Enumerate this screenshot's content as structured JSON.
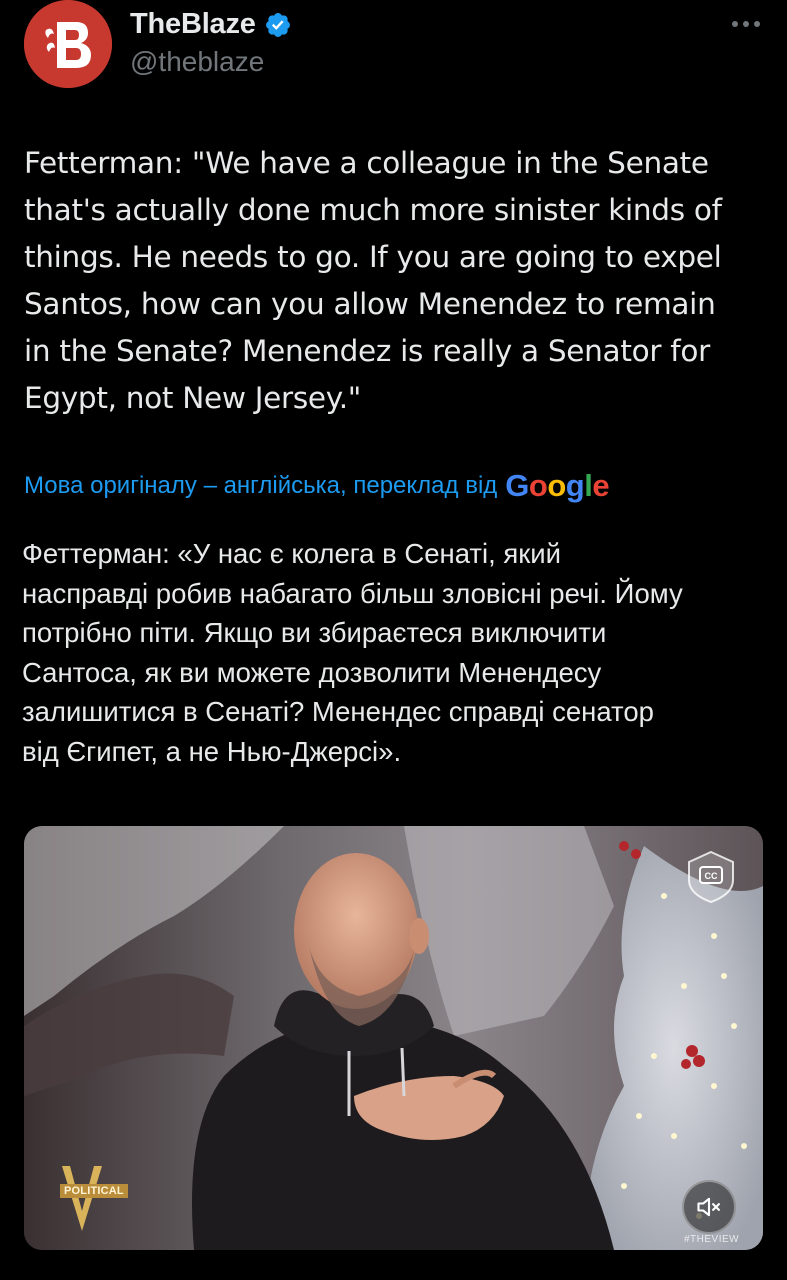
{
  "author": {
    "display_name": "TheBlaze",
    "handle": "@theblaze",
    "verified": true,
    "avatar_color": "#c7392f",
    "verified_color": "#1d9bf0"
  },
  "tweet": {
    "text": "Fetterman: \"We have a colleague in the Senate\nthat's actually done much more sinister kinds of\nthings. He needs to go. If you are going to expel\nSantos, how can you allow Menendez to remain\nin the Senate? Menendez is really a Senator for\nEgypt, not New Jersey.\""
  },
  "translation": {
    "note": "Мова оригіналу – англійська, переклад від",
    "provider": "Google",
    "link_color": "#1d9bf0",
    "text": "Феттерман: «У нас є колега в Сенаті, який\nнасправді робив набагато більш зловісні речі. Йому\nпотрібно піти. Якщо ви збираєтеся виключити\nСантоса, як ви можете дозволити Менендесу\nзалишитися в Сенаті? Менендес справді сенатор\nвід Єгипет, а не Нью-Джерсі»."
  },
  "media": {
    "type": "video",
    "show_badge": "POLITICAL",
    "watermark": "#THEVIEW",
    "cc_icon": "closed-captions-icon",
    "mute_icon": "speaker-muted-icon"
  },
  "google_colors": [
    "#4285f4",
    "#ea4335",
    "#fbbc05",
    "#4285f4",
    "#34a853",
    "#ea4335"
  ]
}
